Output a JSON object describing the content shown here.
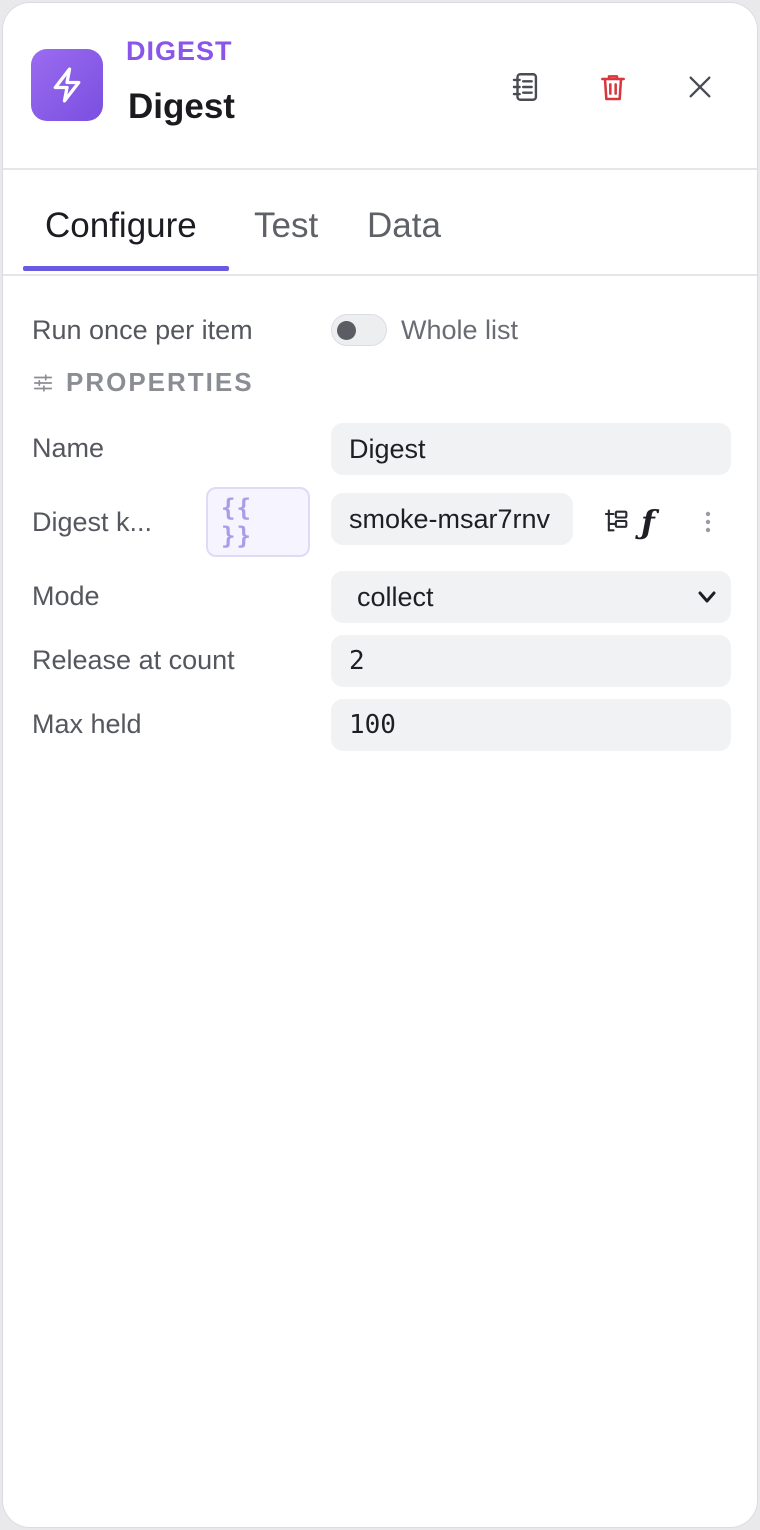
{
  "header": {
    "node_type": "DIGEST",
    "node_title": "Digest",
    "icons": {
      "badge": "lightning-icon",
      "docs": "notebook-icon",
      "delete": "trash-icon",
      "close": "close-icon"
    },
    "colors": {
      "accent": "#8a55e8",
      "delete": "#d9363e"
    }
  },
  "tabs": [
    {
      "label": "Configure",
      "active": true
    },
    {
      "label": "Test",
      "active": false
    },
    {
      "label": "Data",
      "active": false
    }
  ],
  "run_mode": {
    "label": "Run once per item",
    "toggle_label": "Whole list",
    "toggle_on": false
  },
  "properties": {
    "section_title": "PROPERTIES",
    "section_icon": "sliders-icon",
    "name": {
      "label": "Name",
      "value": "Digest"
    },
    "digest_key": {
      "label": "Digest k...",
      "expr_line1": "{{",
      "expr_line2": "}}",
      "value": "smoke-msar7rnv",
      "function_glyph": "ƒ"
    },
    "mode": {
      "label": "Mode",
      "value": "collect"
    },
    "release_at_count": {
      "label": "Release at count",
      "value": "2"
    },
    "max_held": {
      "label": "Max held",
      "value": "100"
    }
  }
}
